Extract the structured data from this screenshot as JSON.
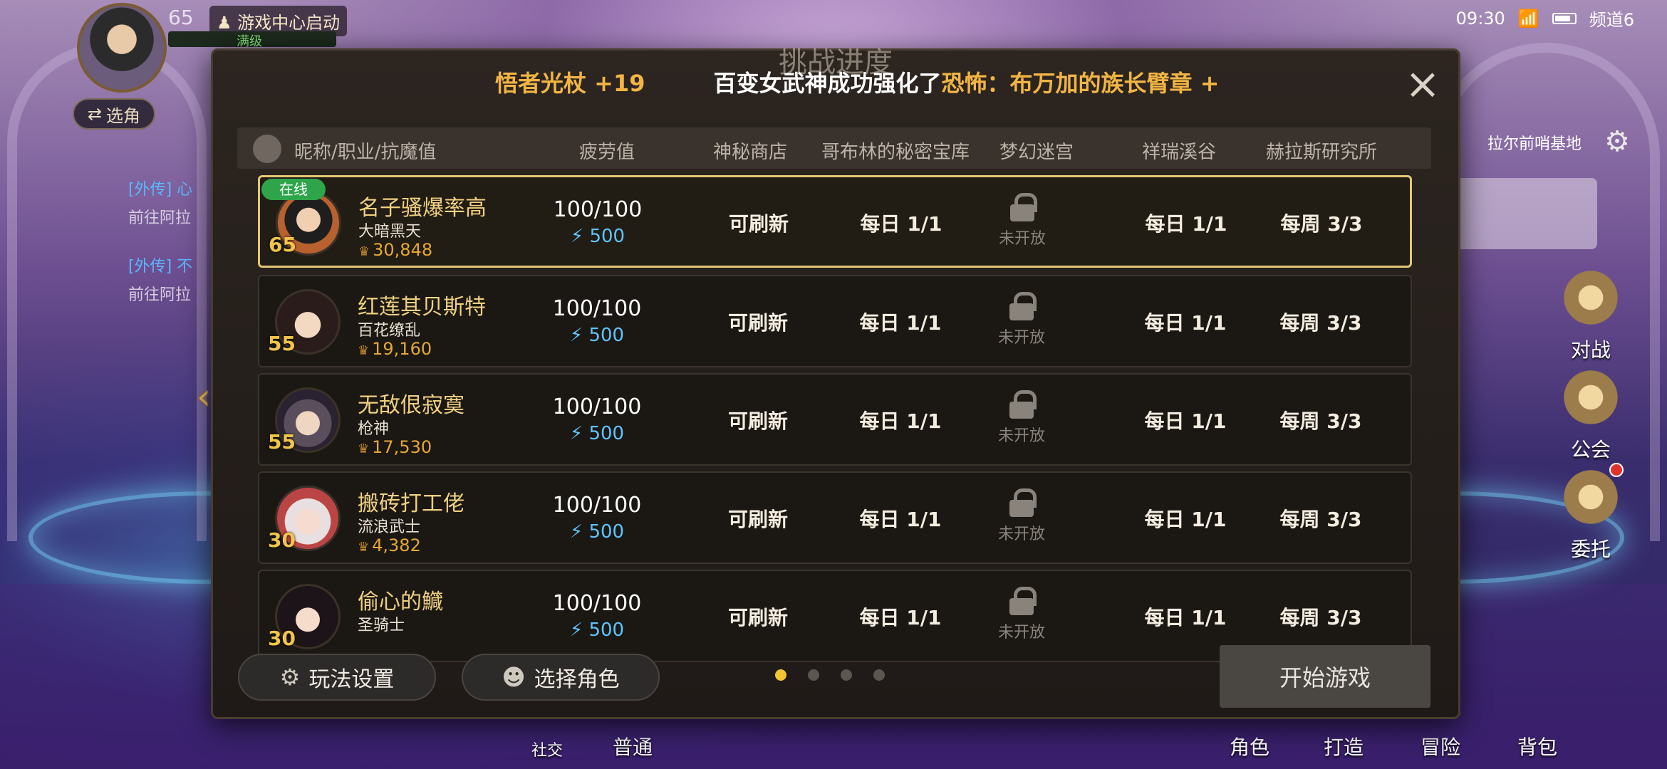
{
  "hud": {
    "level": "65",
    "game_center_label": "游戏中心启动",
    "full_level_label": "满级",
    "switch_char_label": "选角",
    "chat": [
      {
        "tag": "[外传]",
        "text": "心",
        "sub": "前往阿拉"
      },
      {
        "tag": "[外传]",
        "text": "不",
        "sub": "前往阿拉"
      }
    ]
  },
  "status_bar": {
    "time": "09:30",
    "channel": "频道6"
  },
  "right_side": {
    "location": "拉尔前哨基地",
    "menu": [
      {
        "label": "对战",
        "icon": "battle-icon"
      },
      {
        "label": "公会",
        "icon": "guild-icon"
      },
      {
        "label": "委托",
        "icon": "commission-icon"
      }
    ]
  },
  "bottom_nav": {
    "social": "社交",
    "normal": "普通",
    "character": "角色",
    "craft": "打造",
    "adventure": "冒险",
    "bag": "背包"
  },
  "panel": {
    "ghost_title": "挑战进度",
    "ticker": [
      {
        "text": "悟者光杖 +19",
        "color": "gold"
      },
      {
        "text": "　　　百变女武神成功强化了",
        "color": "white"
      },
      {
        "text": "恐怖：布万加的族长臂章 +",
        "color": "gold"
      }
    ],
    "headers": {
      "name_col": "昵称/职业/抗魔值",
      "fatigue": "疲劳值",
      "shop": "神秘商店",
      "goblin": "哥布林的秘密宝库",
      "maze": "梦幻迷宫",
      "valley": "祥瑞溪谷",
      "lab": "赫拉斯研究所"
    },
    "online_label": "在线",
    "rows": [
      {
        "level": "65",
        "name": "名子骚爆率高",
        "job": "大暗黑天",
        "power": "30,848",
        "fatigue": "100/100",
        "fatigue_extra": "500",
        "shop": "可刷新",
        "goblin": "每日 1/1",
        "maze": "未开放",
        "valley": "每日 1/1",
        "lab": "每周 3/3"
      },
      {
        "level": "55",
        "name": "红莲其贝斯特",
        "job": "百花缭乱",
        "power": "19,160",
        "fatigue": "100/100",
        "fatigue_extra": "500",
        "shop": "可刷新",
        "goblin": "每日 1/1",
        "maze": "未开放",
        "valley": "每日 1/1",
        "lab": "每周 3/3"
      },
      {
        "level": "55",
        "name": "无敌佷寂寞",
        "job": "枪神",
        "power": "17,530",
        "fatigue": "100/100",
        "fatigue_extra": "500",
        "shop": "可刷新",
        "goblin": "每日 1/1",
        "maze": "未开放",
        "valley": "每日 1/1",
        "lab": "每周 3/3"
      },
      {
        "level": "30",
        "name": "搬砖打工佬",
        "job": "流浪武士",
        "power": "4,382",
        "fatigue": "100/100",
        "fatigue_extra": "500",
        "shop": "可刷新",
        "goblin": "每日 1/1",
        "maze": "未开放",
        "valley": "每日 1/1",
        "lab": "每周 3/3"
      },
      {
        "level": "30",
        "name": "偷心的鱵",
        "job": "圣骑士",
        "power": "",
        "fatigue": "100/100",
        "fatigue_extra": "500",
        "shop": "可刷新",
        "goblin": "每日 1/1",
        "maze": "未开放",
        "valley": "每日 1/1",
        "lab": "每周 3/3"
      }
    ],
    "settings_label": "玩法设置",
    "select_char_label": "选择角色",
    "start_label": "开始游戏",
    "pages": 4,
    "current_page": 1
  }
}
